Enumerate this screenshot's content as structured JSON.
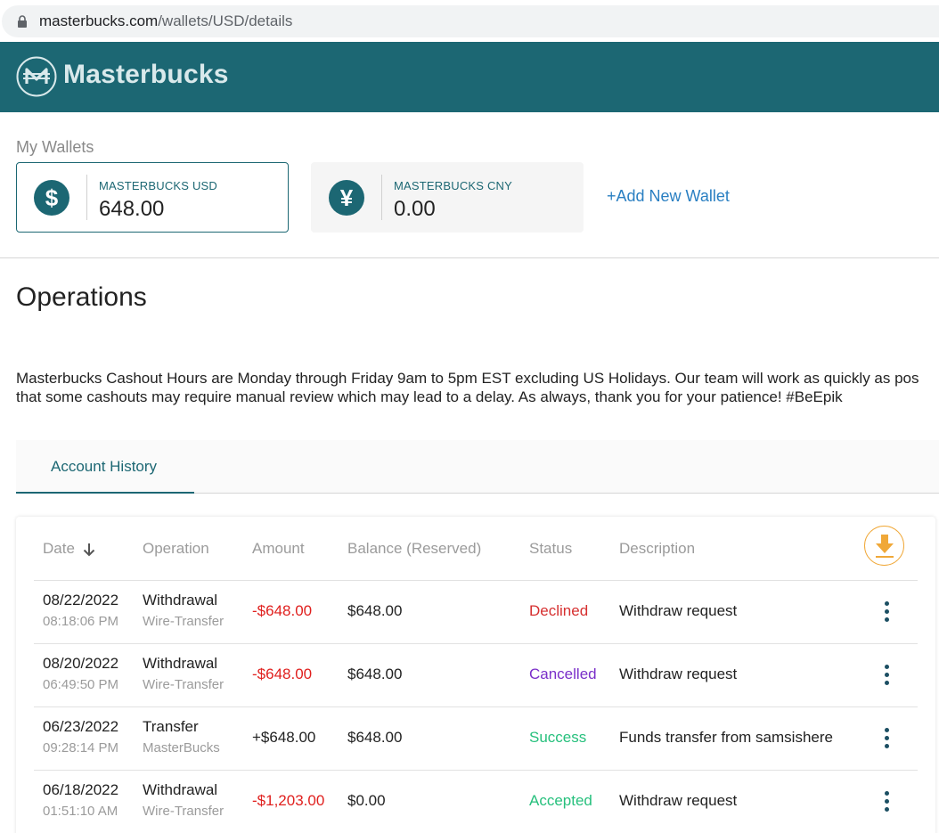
{
  "browser": {
    "url_host": "masterbucks.com",
    "url_path": "/wallets/USD/details"
  },
  "header": {
    "brand": "Masterbucks"
  },
  "wallets": {
    "title": "My Wallets",
    "items": [
      {
        "symbol": "$",
        "name": "MASTERBUCKS USD",
        "amount": "648.00"
      },
      {
        "symbol": "¥",
        "name": "MASTERBUCKS CNY",
        "amount": "0.00"
      }
    ],
    "add_label": "+Add New Wallet"
  },
  "operations": {
    "title": "Operations",
    "notice_line1": "Masterbucks Cashout Hours are Monday through Friday 9am to 5pm EST excluding US Holidays. Our team will work as quickly as pos",
    "notice_line2": "that some cashouts may require manual review which may lead to a delay. As always, thank you for your patience! #BeEpik"
  },
  "tabs": [
    {
      "label": "Account History"
    }
  ],
  "table": {
    "headers": {
      "date": "Date",
      "operation": "Operation",
      "amount": "Amount",
      "balance": "Balance (Reserved)",
      "status": "Status",
      "description": "Description"
    },
    "rows": [
      {
        "date": "08/22/2022",
        "time": "08:18:06 PM",
        "operation": "Withdrawal",
        "method": "Wire-Transfer",
        "amount": "-$648.00",
        "balance": "$648.00",
        "status": "Declined",
        "description": "Withdraw request"
      },
      {
        "date": "08/20/2022",
        "time": "06:49:50 PM",
        "operation": "Withdrawal",
        "method": "Wire-Transfer",
        "amount": "-$648.00",
        "balance": "$648.00",
        "status": "Cancelled",
        "description": "Withdraw request"
      },
      {
        "date": "06/23/2022",
        "time": "09:28:14 PM",
        "operation": "Transfer",
        "method": "MasterBucks",
        "amount": "+$648.00",
        "balance": "$648.00",
        "status": "Success",
        "description": "Funds transfer from samsishere"
      },
      {
        "date": "06/18/2022",
        "time": "01:51:10 AM",
        "operation": "Withdrawal",
        "method": "Wire-Transfer",
        "amount": "-$1,203.00",
        "balance": "$0.00",
        "status": "Accepted",
        "description": "Withdraw request"
      }
    ]
  },
  "colors": {
    "brand": "#1c6773",
    "negative": "#e0201e",
    "declined": "#d63030",
    "cancelled": "#7a2fc9",
    "success": "#27c07d",
    "download": "#f0a838"
  }
}
